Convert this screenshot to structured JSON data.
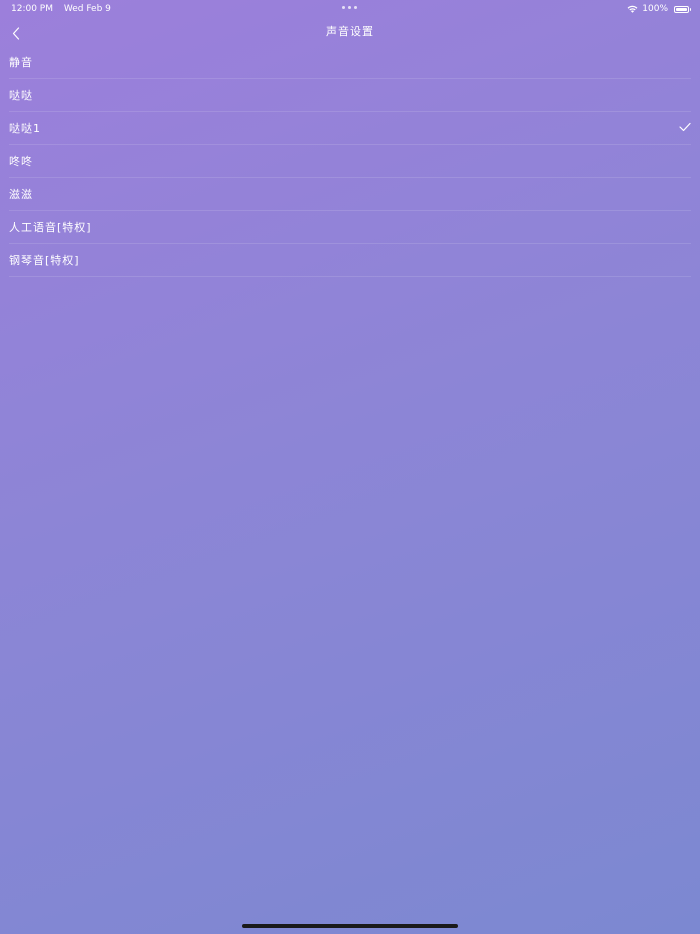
{
  "status_bar": {
    "time": "12:00 PM",
    "date": "Wed Feb 9",
    "battery_percent": "100%",
    "wifi_icon": "wifi-icon",
    "battery_icon": "battery-icon"
  },
  "nav": {
    "title": "声音设置",
    "back_icon": "chevron-left-icon"
  },
  "sound_options": [
    {
      "label": "静音",
      "selected": false
    },
    {
      "label": "哒哒",
      "selected": false
    },
    {
      "label": "哒哒1",
      "selected": true
    },
    {
      "label": "咚咚",
      "selected": false
    },
    {
      "label": "滋滋",
      "selected": false
    },
    {
      "label": "人工语音[特权]",
      "selected": false
    },
    {
      "label": "钢琴音[特权]",
      "selected": false
    }
  ],
  "colors": {
    "background_top": "#9c7fdb",
    "background_bottom": "#7c88d1",
    "text": "#ffffff"
  }
}
